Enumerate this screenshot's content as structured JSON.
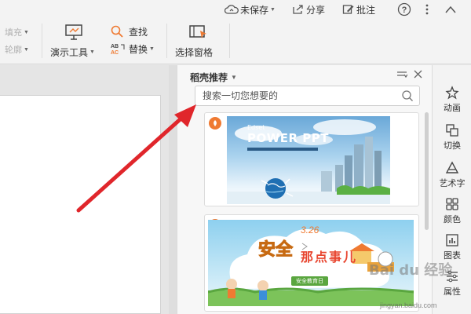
{
  "topbar": {
    "unsaved_label": "未保存",
    "share_label": "分享",
    "comment_label": "批注",
    "help_icon": "help-icon",
    "more_icon": "more-icon",
    "collapse_icon": "collapse-icon"
  },
  "ribbon": {
    "fill_label": "填充",
    "outline_label": "轮廓",
    "present_tools_label": "演示工具",
    "find_label": "查找",
    "replace_label": "替换",
    "select_pane_label": "选择窗格"
  },
  "panel": {
    "title": "稻壳推荐",
    "search_placeholder": "搜索一切您想要的",
    "cards": [
      {
        "thumb_title": "POWER PPT",
        "thumb_small": "Edset"
      },
      {
        "thumb_title": "安全",
        "thumb_title2": "那点事儿",
        "thumb_date": "3.26",
        "thumb_sub": "安全教育日"
      }
    ]
  },
  "rail": {
    "items": [
      {
        "label": "动画"
      },
      {
        "label": "切换"
      },
      {
        "label": "艺术字"
      },
      {
        "label": "颜色"
      },
      {
        "label": "图表"
      },
      {
        "label": "属性"
      }
    ]
  },
  "watermark": {
    "text": "Bai du 经验",
    "url": "jingyan.baidu.com"
  },
  "colors": {
    "accent": "#ef7a32",
    "arrow": "#e0262b",
    "brand_orange": "#ef7a32"
  }
}
